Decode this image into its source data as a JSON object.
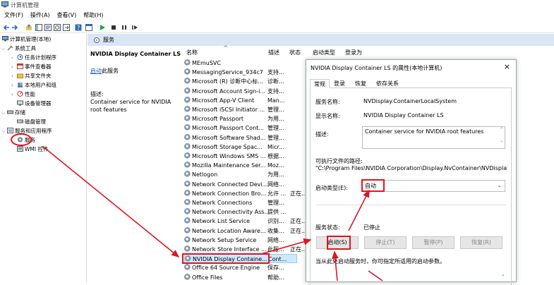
{
  "window": {
    "title": "计算机管理"
  },
  "menu": [
    "文件(F)",
    "操作(A)",
    "查看(V)",
    "帮助(H)"
  ],
  "tree": {
    "root": "计算机管理(本地)",
    "system_tools": "系统工具",
    "task_scheduler": "任务计划程序",
    "event_viewer": "事件查看器",
    "shared_folders": "共享文件夹",
    "local_users": "本地用户和组",
    "performance": "性能",
    "device_manager": "设备管理器",
    "storage": "存储",
    "disk_management": "磁盘管理",
    "services_apps": "服务和应用程序",
    "services": "服务",
    "wmi": "WMI 控件"
  },
  "header": {
    "label": "服务"
  },
  "desc": {
    "service_title": "NVIDIA Display Container LS",
    "start_link": "启动",
    "start_suffix": "此服务",
    "desc_label": "描述:",
    "desc_text": "Container service for NVIDIA root features"
  },
  "columns": {
    "name": "名称",
    "desc": "描述",
    "status": "状态",
    "startup": "启动类型",
    "logon": "登录为"
  },
  "rows": [
    {
      "name": "MEmuSVC",
      "desc": "",
      "status": ""
    },
    {
      "name": "MessagingService_934c7",
      "desc": "支持...",
      "status": ""
    },
    {
      "name": "Microsoft (R) 诊断中心标...",
      "desc": "诊断...",
      "status": ""
    },
    {
      "name": "Microsoft Account Sign-i...",
      "desc": "支持...",
      "status": ""
    },
    {
      "name": "Microsoft App-V Client",
      "desc": "Man...",
      "status": ""
    },
    {
      "name": "Microsoft iSCSI Initiator ...",
      "desc": "管理...",
      "status": ""
    },
    {
      "name": "Microsoft Passport",
      "desc": "为用...",
      "status": ""
    },
    {
      "name": "Microsoft Passport Cont...",
      "desc": "管理...",
      "status": ""
    },
    {
      "name": "Microsoft Software Shad...",
      "desc": "管理...",
      "status": ""
    },
    {
      "name": "Microsoft Storage Spac...",
      "desc": "Micr...",
      "status": ""
    },
    {
      "name": "Microsoft Windows SMS ...",
      "desc": "根据...",
      "status": ""
    },
    {
      "name": "Mozilla Maintenance Ser...",
      "desc": "Moz...",
      "status": ""
    },
    {
      "name": "Netlogon",
      "desc": "为用...",
      "status": ""
    },
    {
      "name": "Network Connected Devi...",
      "desc": "网络...",
      "status": ""
    },
    {
      "name": "Network Connection Bro...",
      "desc": "允许 ...",
      "status": "正在..."
    },
    {
      "name": "Network Connections",
      "desc": "管理...",
      "status": ""
    },
    {
      "name": "Network Connectivity Ass...",
      "desc": "提供 ...",
      "status": ""
    },
    {
      "name": "Network List Service",
      "desc": "识别...",
      "status": "正在..."
    },
    {
      "name": "Network Location Aware...",
      "desc": "收集...",
      "status": "正在..."
    },
    {
      "name": "Network Setup Service",
      "desc": "网络...",
      "status": ""
    },
    {
      "name": "Network Store Interface ...",
      "desc": "此服...",
      "status": "正在..."
    },
    {
      "name": "NVIDIA Display Containe...",
      "desc": "Cont...",
      "status": ""
    },
    {
      "name": "Office 64 Source Engine",
      "desc": "保存...",
      "status": ""
    },
    {
      "name": "Office Files",
      "desc": "帮助...",
      "status": ""
    }
  ],
  "dialog": {
    "title": "NVIDIA Display Container LS 的属性(本地计算机)",
    "close": "×",
    "tabs": [
      "常规",
      "登录",
      "恢复",
      "依存关系"
    ],
    "service_name_label": "服务名称:",
    "service_name": "NVDisplay.ContainerLocalSystem",
    "display_name_label": "显示名称:",
    "display_name": "NVIDIA Display Container LS",
    "description_label": "描述:",
    "description": "Container service for NVIDIA root features",
    "exe_path_label": "可执行文件的路径:",
    "exe_path": "\"C:\\Program Files\\NVIDIA Corporation\\Display.NvContainer\\NVDisplay.(",
    "startup_type_label": "启动类型(E):",
    "startup_type": "自动",
    "status_label": "服务状态:",
    "status": "已停止",
    "btn_start": "启动(S)",
    "btn_stop": "停止(T)",
    "btn_pause": "暂停(P)",
    "btn_resume": "恢复(R)",
    "hint": "当从此处启动服务时，你可指定所适用的启动参数。"
  },
  "accent": {
    "red": "#e0141e",
    "selection": "#cde8ff",
    "header": "#d9e6f5"
  }
}
